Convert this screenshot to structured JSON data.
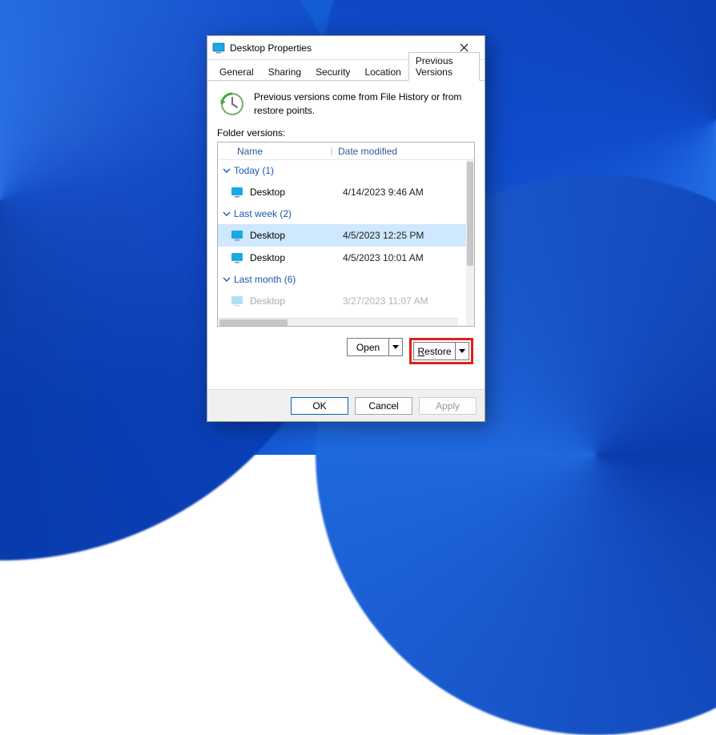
{
  "window": {
    "title": "Desktop Properties"
  },
  "tabs": [
    {
      "label": "General"
    },
    {
      "label": "Sharing"
    },
    {
      "label": "Security"
    },
    {
      "label": "Location"
    },
    {
      "label": "Previous Versions"
    }
  ],
  "active_tab_index": 4,
  "info_text": "Previous versions come from File History or from restore points.",
  "section_label": "Folder versions:",
  "columns": {
    "name": "Name",
    "date": "Date modified"
  },
  "groups": [
    {
      "label": "Today (1)",
      "rows": [
        {
          "name": "Desktop",
          "date": "4/14/2023 9:46 AM",
          "selected": false
        }
      ]
    },
    {
      "label": "Last week (2)",
      "rows": [
        {
          "name": "Desktop",
          "date": "4/5/2023 12:25 PM",
          "selected": true
        },
        {
          "name": "Desktop",
          "date": "4/5/2023 10:01 AM",
          "selected": false
        }
      ]
    },
    {
      "label": "Last month (6)",
      "rows": [
        {
          "name": "Desktop",
          "date": "3/27/2023 11:07 AM",
          "selected": false
        }
      ]
    }
  ],
  "action_buttons": {
    "open": "Open",
    "restore_prefix": "R",
    "restore_suffix": "estore"
  },
  "dialog_buttons": {
    "ok": "OK",
    "cancel": "Cancel",
    "apply": "Apply"
  },
  "colors": {
    "link_blue": "#1b57b0",
    "selection": "#cfe7ff",
    "highlight_red": "#e21e1e"
  }
}
